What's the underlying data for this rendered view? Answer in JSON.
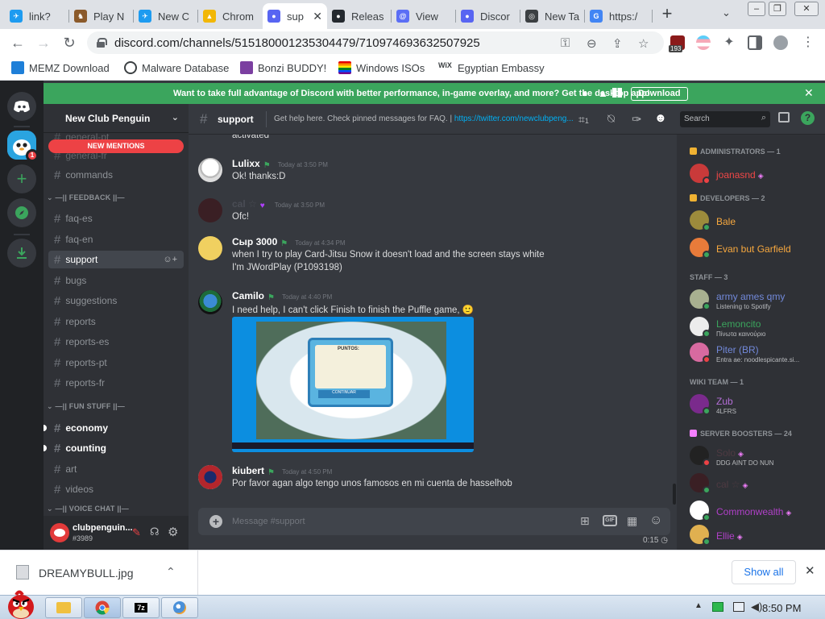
{
  "browser": {
    "tabs": [
      {
        "label": "link?",
        "color": "#1d9bf0",
        "glyph": "✈"
      },
      {
        "label": "Play N",
        "color": "#8b5a2b",
        "glyph": "♞"
      },
      {
        "label": "New C",
        "color": "#1d9bf0",
        "glyph": "✈"
      },
      {
        "label": "Chrom",
        "color": "#f2b705",
        "glyph": "▲"
      },
      {
        "label": "sup",
        "color": "#5865f2",
        "glyph": "●"
      },
      {
        "label": "Releas",
        "color": "#24292f",
        "glyph": "●"
      },
      {
        "label": "View",
        "color": "#5b6ef5",
        "glyph": "@"
      },
      {
        "label": "Discor",
        "color": "#5865f2",
        "glyph": "●"
      },
      {
        "label": "New Ta",
        "color": "#3c4043",
        "glyph": "◎"
      },
      {
        "label": "https:/",
        "color": "#4285f4",
        "glyph": "G"
      }
    ],
    "new_tab_label": "+",
    "tab_search_label": "⌄",
    "window_controls": [
      "–",
      "❐",
      "✕"
    ],
    "url": "discord.com/channels/515180001235304479/710974693632507925",
    "nav": {
      "back": "←",
      "forward": "→",
      "reload": "↻"
    },
    "extension_badge": "193",
    "bookmarks": [
      {
        "label": "MEMZ Download",
        "color": "#1e7fd8"
      },
      {
        "label": "Malware Database",
        "color": "#3c4043"
      },
      {
        "label": "Bonzi BUDDY!",
        "color": "#7b3fa0"
      },
      {
        "label": "Windows ISOs",
        "color": "#e0302c"
      },
      {
        "label": "Egyptian Embassy",
        "color": "#ffffff"
      }
    ],
    "bookmark_wix": "WiX"
  },
  "discord": {
    "banner": {
      "text": "Want to take full advantage of Discord with better performance, in-game overlay, and more? Get the desktop app!",
      "download_label": "Download",
      "close": "✕"
    },
    "server": {
      "name": "New Club Penguin",
      "new_mentions_label": "NEW MENTIONS",
      "guild_badge": "1"
    },
    "channel_items": [
      {
        "kind": "channel",
        "label": "general-pt",
        "state": "muted"
      },
      {
        "kind": "channel",
        "label": "general-fr",
        "state": "muted"
      },
      {
        "kind": "channel",
        "label": "commands",
        "state": "normal"
      },
      {
        "kind": "category",
        "label": "—|| FEEDBACK ||—"
      },
      {
        "kind": "channel",
        "label": "faq-es",
        "state": "normal"
      },
      {
        "kind": "channel",
        "label": "faq-en",
        "state": "normal"
      },
      {
        "kind": "channel",
        "label": "support",
        "state": "selected"
      },
      {
        "kind": "channel",
        "label": "bugs",
        "state": "normal"
      },
      {
        "kind": "channel",
        "label": "suggestions",
        "state": "normal"
      },
      {
        "kind": "channel",
        "label": "reports",
        "state": "normal"
      },
      {
        "kind": "channel",
        "label": "reports-es",
        "state": "normal"
      },
      {
        "kind": "channel",
        "label": "reports-pt",
        "state": "normal"
      },
      {
        "kind": "channel",
        "label": "reports-fr",
        "state": "normal"
      },
      {
        "kind": "category",
        "label": "—|| FUN STUFF ||—"
      },
      {
        "kind": "channel",
        "label": "economy",
        "state": "unread"
      },
      {
        "kind": "channel",
        "label": "counting",
        "state": "unread"
      },
      {
        "kind": "channel",
        "label": "art",
        "state": "normal"
      },
      {
        "kind": "channel",
        "label": "videos",
        "state": "normal"
      },
      {
        "kind": "category",
        "label": "—|| VOICE CHAT ||—"
      }
    ],
    "user": {
      "name": "clubpenguin...",
      "tag": "#3989"
    },
    "channel_header": {
      "name": "support",
      "topic": "Get help here. Check pinned messages for FAQ. | ",
      "topic_link": "https://twitter.com/newclubpeng...",
      "search_placeholder": "Search",
      "threads_count": "1"
    },
    "messages": [
      {
        "author": "",
        "time": "",
        "lines": [
          "activated"
        ],
        "color": "#ffffff",
        "avatar": ""
      },
      {
        "author": "Lulixx",
        "time": "Today at 3:50 PM",
        "lines": [
          "Ok! thanks:D"
        ],
        "color": "#ffffff",
        "avatar": "#e8e8e8"
      },
      {
        "author": "cal ☆",
        "time": "Today at 3:50 PM",
        "lines": [
          "Ofc!"
        ],
        "color": "#4a4d55",
        "avatar": "#3a1f24"
      },
      {
        "author": "Сыр 3000",
        "time": "Today at 4:34 PM",
        "lines": [
          "when I try to play Card-Jitsu Snow it doesn't load and the screen stays white",
          "I'm JWordPlay (P1093198)"
        ],
        "color": "#ffffff",
        "avatar": "#f0d060"
      },
      {
        "author": "Camilo",
        "time": "Today at 4:40 PM",
        "lines": [
          "I need help, I can't click Finish to finish the Puffle game, 🙂"
        ],
        "color": "#ffffff",
        "avatar": "#1d6b3a"
      },
      {
        "author": "kiubert",
        "time": "Today at 4:50 PM",
        "lines": [
          "Por favor agan algo tengo unos famosos en mi cuenta de hasselhob"
        ],
        "color": "#ffffff",
        "avatar": "#b3262c"
      }
    ],
    "attachment": {
      "title": "PUNTOS:",
      "button": "CONTINUAR"
    },
    "composer": {
      "placeholder": "Message #support",
      "gif_label": "GIF"
    },
    "slowmode": "0:15 ◷",
    "members": [
      {
        "kind": "category",
        "label": "ADMINISTRATORS — 1",
        "icon_color": "#f0b232"
      },
      {
        "kind": "member",
        "name": "joanasnd",
        "status": "",
        "color": "#f04747",
        "avatar": "#c93a3a",
        "presence": "#ed4245",
        "boost": true
      },
      {
        "kind": "category",
        "label": "DEVELOPERS — 2",
        "icon_color": "#f0b232"
      },
      {
        "kind": "member",
        "name": "Bale",
        "status": "",
        "color": "#f7a83e",
        "avatar": "#9c8b3c",
        "presence": "#3ba55d",
        "boost": false
      },
      {
        "kind": "member",
        "name": "Evan but Garfield",
        "status": "",
        "color": "#f7a83e",
        "avatar": "#e87b3a",
        "presence": "#3ba55d",
        "boost": false
      },
      {
        "kind": "category",
        "label": "STAFF — 3",
        "icon_color": ""
      },
      {
        "kind": "member",
        "name": "army ames qmy",
        "status": "Listening to Spotify",
        "color": "#7289da",
        "avatar": "#a8b090",
        "presence": "#3ba55d",
        "boost": false
      },
      {
        "kind": "member",
        "name": "Lemoncito",
        "status": "Πίνωτα καινούριο",
        "color": "#3ba55d",
        "avatar": "#ececec",
        "presence": "#3ba55d",
        "boost": false
      },
      {
        "kind": "member",
        "name": "Piter (BR)",
        "status": "Entra ae: noodlespicante.si...",
        "color": "#7289da",
        "avatar": "#d86aa0",
        "presence": "#ed4245",
        "boost": false
      },
      {
        "kind": "category",
        "label": "WIKI TEAM — 1",
        "icon_color": ""
      },
      {
        "kind": "member",
        "name": "Zub",
        "status": "4LFRS",
        "color": "#b36ed6",
        "avatar": "#7a2a8c",
        "presence": "#3ba55d",
        "boost": false
      },
      {
        "kind": "category",
        "label": "SERVER BOOSTERS — 24",
        "icon_color": "#f47fff"
      },
      {
        "kind": "member",
        "name": "Solo",
        "status": "DDG AINT DO NUN",
        "color": "#4e3a42",
        "avatar": "#222222",
        "presence": "#ed4245",
        "boost": true
      },
      {
        "kind": "member",
        "name": "cal ☆",
        "status": "",
        "color": "#4e3a42",
        "avatar": "#3a1f24",
        "presence": "#3ba55d",
        "boost": true
      },
      {
        "kind": "member",
        "name": "Commonwealth",
        "status": "",
        "color": "#b040c8",
        "avatar": "#ffffff",
        "presence": "#3ba55d",
        "boost": true
      },
      {
        "kind": "member",
        "name": "Ellie",
        "status": "",
        "color": "#b040c8",
        "avatar": "#e0b050",
        "presence": "#3ba55d",
        "boost": true
      }
    ]
  },
  "downloads": {
    "file": "DREAMYBULL.jpg",
    "show_all": "Show all",
    "close": "✕"
  },
  "taskbar": {
    "time": "8:50 PM",
    "app_7z": "7z"
  }
}
